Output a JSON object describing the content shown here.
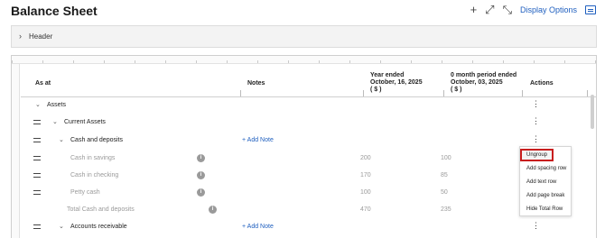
{
  "page": {
    "title": "Balance Sheet",
    "display_options": "Display Options"
  },
  "header_panel": {
    "label": "Header"
  },
  "table": {
    "columns": {
      "as_at": "As at",
      "notes": "Notes",
      "col1_line1": "Year ended",
      "col1_line2": "October, 16, 2025",
      "col1_line3": "( $ )",
      "col2_line1": "0 month period ended",
      "col2_line2": "October, 03, 2025",
      "col2_line3": "( $ )",
      "actions": "Actions"
    },
    "rows": [
      {
        "label": "Assets"
      },
      {
        "label": "Current Assets"
      },
      {
        "label": "Cash and deposits",
        "note_action": "+ Add Note"
      },
      {
        "label": "Cash in savings",
        "v1": "200",
        "v2": "100"
      },
      {
        "label": "Cash in checking",
        "v1": "170",
        "v2": "85"
      },
      {
        "label": "Petty cash",
        "v1": "100",
        "v2": "50"
      },
      {
        "label": "Total Cash and deposits",
        "v1": "470",
        "v2": "235"
      },
      {
        "label": "Accounts receivable",
        "note_action": "+ Add Note"
      }
    ]
  },
  "context_menu": {
    "items": [
      "Ungroup",
      "Add spacing row",
      "Add text row",
      "Add page break",
      "Hide Total Row"
    ]
  },
  "icons": {
    "plus": "plus-icon",
    "expand": "expand-icon",
    "collapse": "collapse-icon",
    "display": "display-options-icon",
    "info": "info-icon",
    "kebab": "kebab-icon",
    "drag": "drag-handle-icon",
    "chevron": "chevron-icon"
  },
  "colors": {
    "accent": "#1f5fbf",
    "highlight_border": "#c81e1e"
  }
}
